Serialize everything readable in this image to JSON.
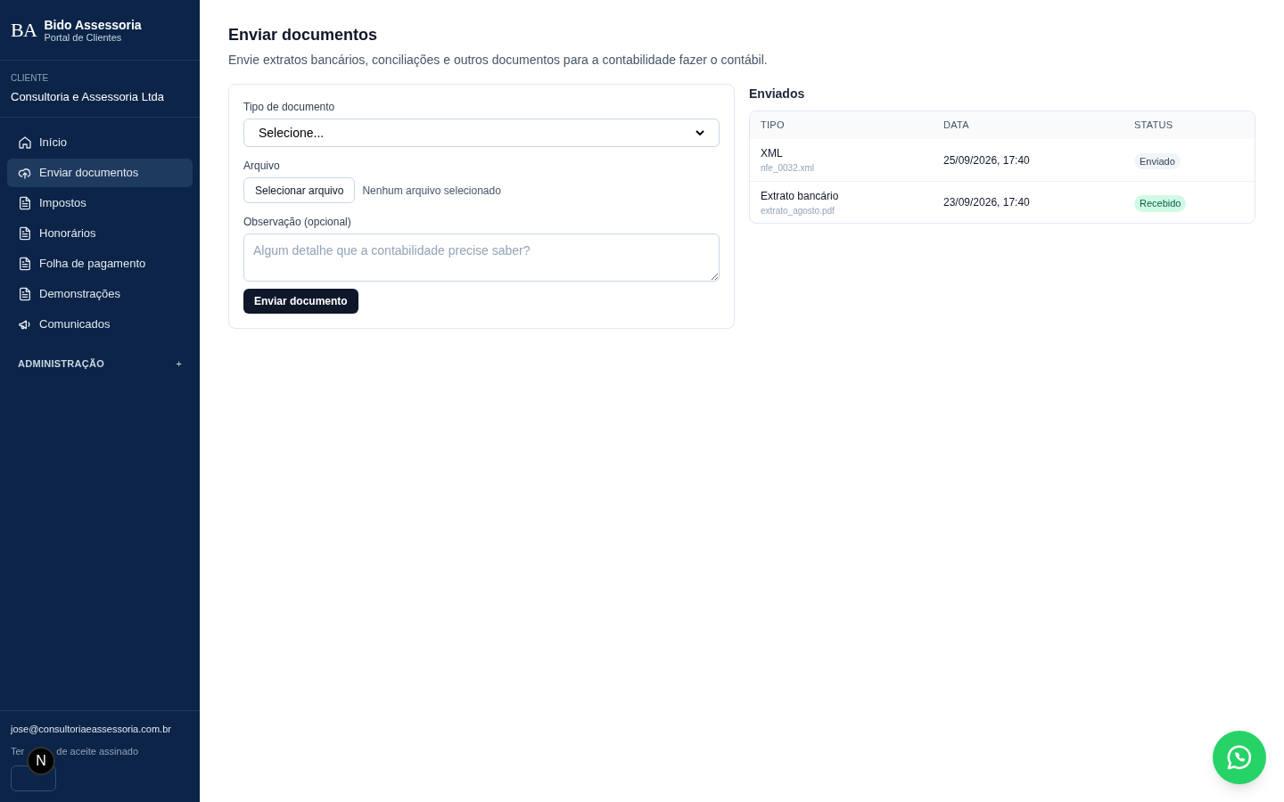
{
  "brand": {
    "logo": "BA",
    "name": "Bido Assessoria",
    "subtitle": "Portal de Clientes"
  },
  "client": {
    "label": "CLIENTE",
    "name": "Consultoria e Assessoria Ltda"
  },
  "nav": [
    {
      "label": "Início",
      "kind": "home",
      "selected": false
    },
    {
      "label": "Enviar documentos",
      "kind": "upload",
      "selected": true
    },
    {
      "label": "Impostos",
      "kind": "file",
      "selected": false
    },
    {
      "label": "Honorários",
      "kind": "file",
      "selected": false
    },
    {
      "label": "Folha de pagamento",
      "kind": "file",
      "selected": false
    },
    {
      "label": "Demonstrações",
      "kind": "file",
      "selected": false
    },
    {
      "label": "Comunicados",
      "kind": "megaphone",
      "selected": false
    }
  ],
  "admin": {
    "label": "ADMINISTRAÇÃO",
    "toggle": "+"
  },
  "footer": {
    "email": "jose@consultoriaeassessoria.com.br",
    "terms_before": "Ter",
    "terms_after": "de aceite assinado",
    "badge": "N"
  },
  "page": {
    "title": "Enviar documentos",
    "subtitle": "Envie extratos bancários, conciliações e outros documentos para a contabilidade fazer o contábil."
  },
  "form": {
    "type_label": "Tipo de documento",
    "type_value": "Selecione...",
    "file_label": "Arquivo",
    "file_button": "Selecionar arquivo",
    "file_status": "Nenhum arquivo selecionado",
    "note_label": "Observação (opcional)",
    "note_placeholder": "Algum detalhe que a contabilidade precise saber?",
    "submit": "Enviar documento"
  },
  "sent": {
    "title": "Enviados",
    "columns": [
      "TIPO",
      "DATA",
      "STATUS"
    ],
    "rows": [
      {
        "type": "XML",
        "file": "nfe_0032.xml",
        "date": "25/09/2026, 17:40",
        "status": "Enviado",
        "kind": "sent"
      },
      {
        "type": "Extrato bancário",
        "file": "extrato_agosto.pdf",
        "date": "23/09/2026, 17:40",
        "status": "Recebido",
        "kind": "received"
      }
    ]
  }
}
